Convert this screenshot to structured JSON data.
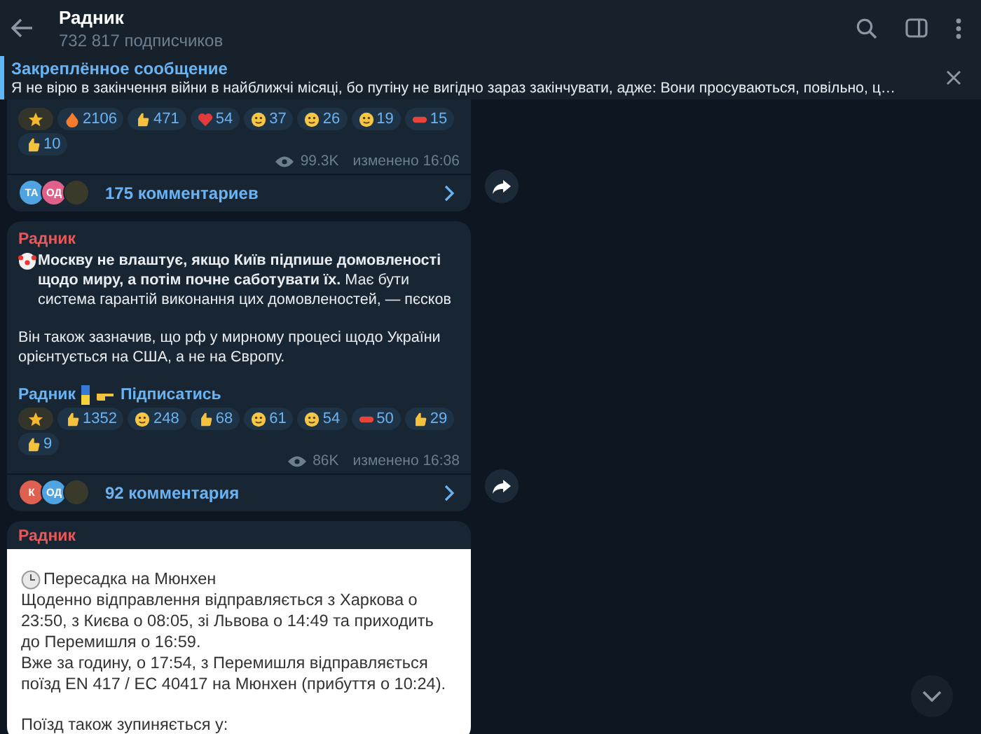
{
  "header": {
    "title": "Радник",
    "subtitle": "732 817 подписчиков"
  },
  "pinned": {
    "label": "Закреплённое сообщение",
    "text": "Я не вірю в закінчення війни в найближчі місяці, бо путіну не вигідно зараз закінчувати, адже:  Вони просуваються, повільно, ц…"
  },
  "posts": [
    {
      "kind": "partial",
      "reactions": [
        {
          "kind": "star"
        },
        {
          "kind": "fire",
          "count": "2106"
        },
        {
          "kind": "hand",
          "count": "471"
        },
        {
          "kind": "heart",
          "count": "54"
        },
        {
          "kind": "face",
          "count": "37"
        },
        {
          "kind": "face",
          "count": "26"
        },
        {
          "kind": "face",
          "count": "19"
        },
        {
          "kind": "pill",
          "count": "15"
        },
        {
          "kind": "hand",
          "count": "10"
        }
      ],
      "views": "99.3K",
      "time": "изменено 16:06",
      "commenters": [
        {
          "kind": "initials",
          "initials": "ТА",
          "color": "#4fa3e0"
        },
        {
          "kind": "initials",
          "initials": "ОД",
          "color": "#e0608a"
        },
        {
          "kind": "photo"
        }
      ],
      "comments": "175 комментариев"
    },
    {
      "kind": "text",
      "author": "Радник",
      "paragraphs": [
        "**Москву не влаштує, якщо Київ підпише домовленості щодо миру, а потім почне саботувати їх.** Має бути система гарантій виконання цих домовленостей, — пєсков",
        "Він також зазначив, що рф у мирному процесі щодо України орієнтується на США, а не на Європу."
      ],
      "signature": "Радник",
      "subscribe": "Підписатись",
      "reactions": [
        {
          "kind": "star"
        },
        {
          "kind": "hand",
          "count": "1352"
        },
        {
          "kind": "face",
          "count": "248"
        },
        {
          "kind": "hand",
          "count": "68"
        },
        {
          "kind": "face",
          "count": "61"
        },
        {
          "kind": "face",
          "count": "54"
        },
        {
          "kind": "pill",
          "count": "50"
        },
        {
          "kind": "hand",
          "count": "29"
        },
        {
          "kind": "hand",
          "count": "9"
        }
      ],
      "views": "86K",
      "time": "изменено 16:38",
      "commenters": [
        {
          "kind": "initials",
          "initials": "К",
          "color": "#e0604f"
        },
        {
          "kind": "initials",
          "initials": "ОД",
          "color": "#4fa3e0"
        },
        {
          "kind": "photo"
        }
      ],
      "comments": "92 комментария"
    },
    {
      "kind": "image",
      "author": "Радник",
      "blocks": [
        [
          "Пересадка на Мюнхен",
          "Щоденно відправлення відправляється з Харкова о 23:50, з Києва о 08:05, зі Львова о 14:49 та приходить до Перемишля о 16:59.",
          "Вже за годину, о 17:54, з Перемишля відправляється поїзд EN 417 / EC 40417 на Мюнхен (прибуття о 10:24)."
        ],
        [
          "Поїзд також зупиняється у:"
        ]
      ]
    }
  ]
}
